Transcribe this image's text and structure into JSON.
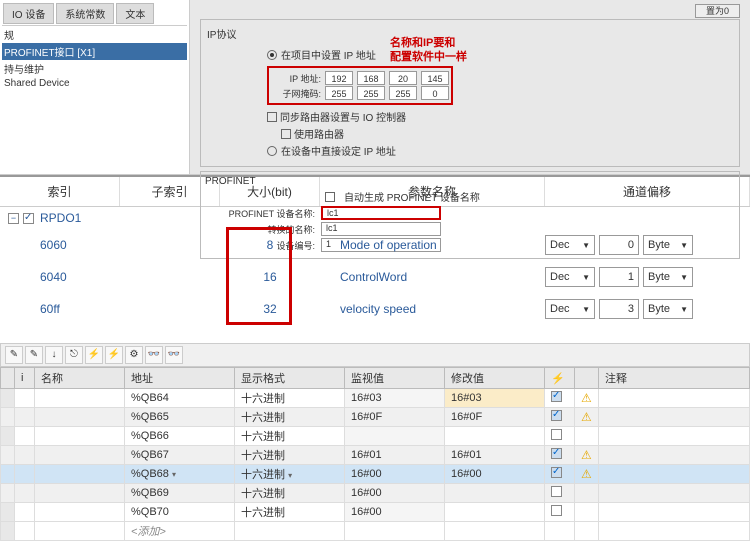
{
  "top": {
    "tree": {
      "item0": "IO 设备",
      "item1": "系统常数",
      "item2": "文本",
      "root": "规",
      "pn": "PROFINET接口 [X1]",
      "sub1": "持与维护",
      "sub2": "Shared Device"
    },
    "tabs": {
      "t1": "IO 设备",
      "t2": "系统常数",
      "t3": "文本"
    },
    "btn_zero": "置为0",
    "ip_section_title": "IP协议",
    "radio1": "在项目中设置 IP 地址",
    "ip_label": "IP 地址:",
    "mask_label": "子网掩码:",
    "ip": [
      "192",
      "168",
      "20",
      "145"
    ],
    "mask": [
      "255",
      "255",
      "255",
      "0"
    ],
    "radio2": "同步路由器设置与 IO 控制器",
    "chk_router": "使用路由器",
    "radio3": "在设备中直接设定 IP 地址",
    "note1": "名称和IP要和",
    "note2": "配置软件中一样",
    "pn_title": "PROFINET",
    "pn_auto": "自动生成 PROFINET 设备名称",
    "pn_name_label": "PROFINET 设备名称:",
    "pn_name": "lc1",
    "conv_label": "转换的名称:",
    "conv_val": "lc1",
    "dev_label": "设备编号:",
    "dev_val": "1"
  },
  "mid": {
    "h1": "索引",
    "h2": "子索引",
    "h3": "大小(bit)",
    "h4": "参数名称",
    "h5": "通道偏移",
    "group": "RPDO1",
    "rows": [
      {
        "idx": "6060",
        "size": "8",
        "name": "Mode of operation",
        "num": "0"
      },
      {
        "idx": "6040",
        "size": "16",
        "name": "ControlWord",
        "num": "1"
      },
      {
        "idx": "60ff",
        "size": "32",
        "name": "velocity speed",
        "num": "3"
      }
    ],
    "dec": "Dec",
    "byte": "Byte"
  },
  "bottom": {
    "th_i": "i",
    "th_name": "名称",
    "th_addr": "地址",
    "th_fmt": "显示格式",
    "th_mon": "监视值",
    "th_mod": "修改值",
    "th_chk": "",
    "th_note": "注释",
    "fmt": "十六进制",
    "rows": [
      {
        "addr": "%QB64",
        "mon": "16#03",
        "mod": "16#03",
        "chk": true,
        "warn": true
      },
      {
        "addr": "%QB65",
        "mon": "16#0F",
        "mod": "16#0F",
        "chk": true,
        "warn": true
      },
      {
        "addr": "%QB66",
        "mon": "",
        "mod": "",
        "chk": false,
        "warn": false
      },
      {
        "addr": "%QB67",
        "mon": "16#01",
        "mod": "16#01",
        "chk": true,
        "warn": true
      },
      {
        "addr": "%QB68",
        "mon": "16#00",
        "mod": "16#00",
        "chk": true,
        "warn": true,
        "hl": true
      },
      {
        "addr": "%QB69",
        "mon": "16#00",
        "mod": "",
        "chk": false,
        "warn": false
      },
      {
        "addr": "%QB70",
        "mon": "16#00",
        "mod": "",
        "chk": false,
        "warn": false
      }
    ],
    "add": "<添加>"
  }
}
